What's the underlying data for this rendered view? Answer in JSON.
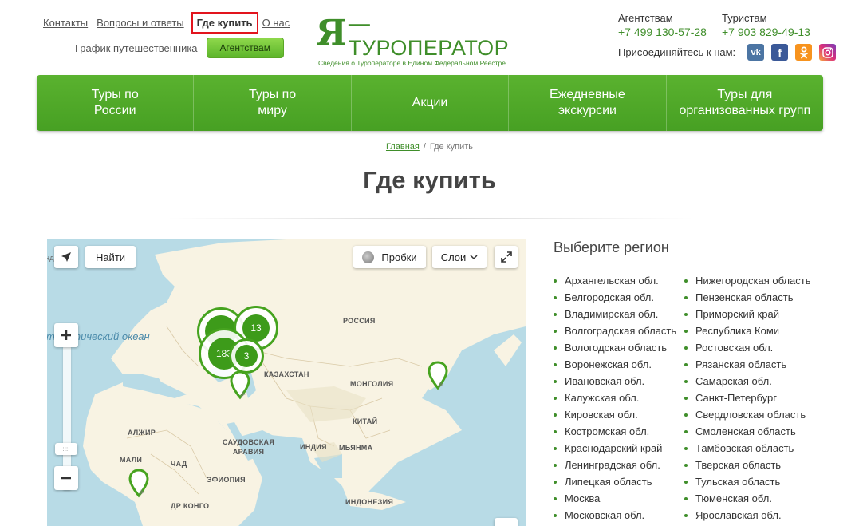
{
  "header": {
    "top_links": [
      "Контакты",
      "Вопросы и ответы",
      "Где купить",
      "О нас"
    ],
    "sub_link": "График путешественника",
    "agencies_button": "Агентствам",
    "logo": {
      "mark": "Я",
      "name": "—ТУРОПЕРАТОР",
      "tagline": "Сведения о Туроператоре в Едином Федеральном Реестре"
    },
    "contacts": {
      "agencies_label": "Агентствам",
      "agencies_phone": "+7 499 130-57-28",
      "tourists_label": "Туристам",
      "tourists_phone": "+7 903 829-49-13"
    },
    "social_label": "Присоединяйтесь к нам:",
    "social_icons": [
      "vk-icon",
      "facebook-icon",
      "odnoklassniki-icon",
      "instagram-icon"
    ]
  },
  "nav": {
    "items": [
      "Туры по\nРоссии",
      "Туры по\nмиру",
      "Акции",
      "Ежедневные\nэкскурсии",
      "Туры для\nорганизованных групп"
    ]
  },
  "breadcrumb": {
    "home": "Главная",
    "separator": "/",
    "current": "Где купить"
  },
  "page_title": "Где купить",
  "map": {
    "find_button": "Найти",
    "traffic_button": "Пробки",
    "layers_button": "Слои",
    "ocean_label": "тлантический океан",
    "ocean_label_left": "ндО",
    "country_labels": [
      "РОССИЯ",
      "КАЗАХСТАН",
      "МОНГОЛИЯ",
      "КИТАЙ",
      "ИНДИЯ",
      "САУДОВСКАЯ\nАРАВИЯ",
      "АЛЖИР",
      "МАЛИ",
      "ЧАД",
      "ЭФИОПИЯ",
      "ДР КОНГО",
      "ИНДОНЕЗИЯ",
      "МЬЯНМА"
    ],
    "clusters": [
      "13",
      "183",
      "3"
    ]
  },
  "regions": {
    "title": "Выберите регион",
    "column1": [
      "Архангельская обл.",
      "Белгородская обл.",
      "Владимирская обл.",
      "Волгоградская область",
      "Вологодская область",
      "Воронежская обл.",
      "Ивановская обл.",
      "Калужская обл.",
      "Кировская обл.",
      "Костромская обл.",
      "Краснодарский край",
      "Ленинградская обл.",
      "Липецкая область",
      "Москва",
      "Московская обл."
    ],
    "column2": [
      "Нижегородская область",
      "Пензенская область",
      "Приморский край",
      "Республика Коми",
      "Ростовская обл.",
      "Рязанская область",
      "Самарская обл.",
      "Санкт-Петербург",
      "Свердловская область",
      "Смоленская область",
      "Тамбовская область",
      "Тверская область",
      "Тульская область",
      "Тюменская обл.",
      "Ярославская обл."
    ]
  }
}
